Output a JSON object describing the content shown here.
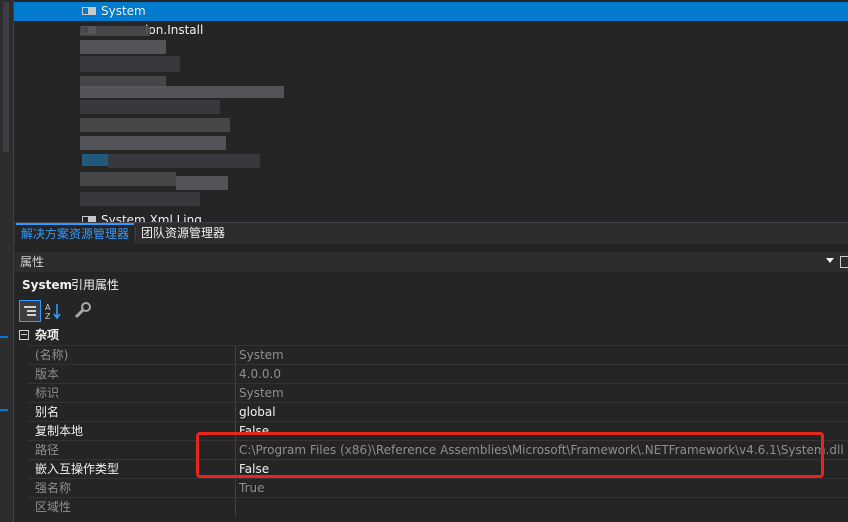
{
  "solution_explorer": {
    "items": [
      {
        "label": "System",
        "selected": true
      },
      {
        "label": "Configuration.Install",
        "selected": false
      },
      {
        "label": "System.Xml.Linq",
        "selected": false
      }
    ]
  },
  "tabs": [
    {
      "label": "解决方案资源管理器",
      "active": true
    },
    {
      "label": "团队资源管理器",
      "active": false
    }
  ],
  "properties_panel": {
    "title": "属性",
    "object_name": "System",
    "object_type": "引用属性",
    "toolbar": {
      "categorized_icon": "categorized-icon",
      "alphabetical_icon": "alphabetical-sort-icon",
      "property_pages_icon": "wrench-icon"
    },
    "category": "杂项",
    "rows": [
      {
        "name": "(名称)",
        "value": "System",
        "readonly": true
      },
      {
        "name": "版本",
        "value": "4.0.0.0",
        "readonly": true
      },
      {
        "name": "标识",
        "value": "System",
        "readonly": true
      },
      {
        "name": "别名",
        "value": "global",
        "readonly": false
      },
      {
        "name": "复制本地",
        "value": "False",
        "readonly": false
      },
      {
        "name": "路径",
        "value": "C:\\Program Files (x86)\\Reference Assemblies\\Microsoft\\Framework\\.NETFramework\\v4.6.1\\System.dll",
        "readonly": true
      },
      {
        "name": "嵌入互操作类型",
        "value": "False",
        "readonly": false
      },
      {
        "name": "强名称",
        "value": "True",
        "readonly": true
      },
      {
        "name": "区域性",
        "value": "",
        "readonly": true
      }
    ]
  },
  "colors": {
    "accent": "#007acc",
    "highlight_box": "#e8241c",
    "background": "#252526"
  }
}
